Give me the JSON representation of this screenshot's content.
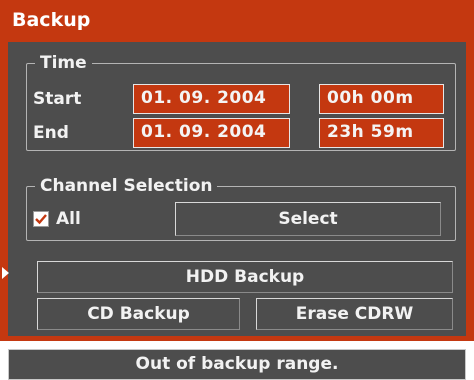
{
  "window": {
    "title": "Backup"
  },
  "time": {
    "group_label": "Time",
    "start_label": "Start",
    "start_date": "01. 09. 2004",
    "start_time": "00h 00m",
    "end_label": "End",
    "end_date": "01. 09. 2004",
    "end_time": "23h 59m"
  },
  "channel": {
    "group_label": "Channel Selection",
    "all_label": "All",
    "all_checked": true,
    "select_label": "Select"
  },
  "actions": {
    "hdd_backup_label": "HDD Backup",
    "cd_backup_label": "CD Backup",
    "erase_cdrw_label": "Erase CDRW"
  },
  "status": {
    "message": "Out of backup range."
  },
  "colors": {
    "accent": "#c43810",
    "panel": "#4d4d4d",
    "text": "#f2f2f2"
  }
}
